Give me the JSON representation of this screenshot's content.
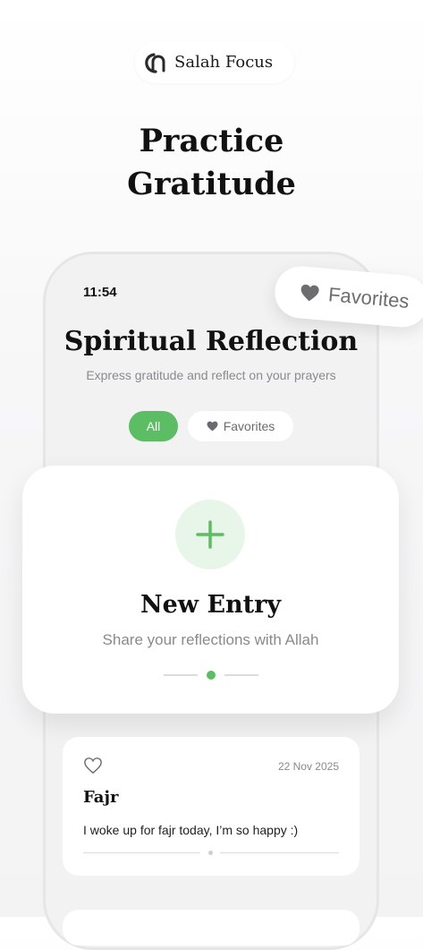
{
  "brand": {
    "name": "Salah Focus",
    "logo_icon": "salah-focus-logo-icon"
  },
  "headline": {
    "line1": "Practice",
    "line2": "Gratitude"
  },
  "status_bar": {
    "time": "11:54"
  },
  "floating_badge": {
    "label": "Favorites",
    "icon": "heart-icon"
  },
  "screen": {
    "title": "Spiritual Reflection",
    "subtitle": "Express gratitude and reflect on your prayers",
    "filters": {
      "all": "All",
      "favorites": "Favorites"
    }
  },
  "new_entry": {
    "title": "New Entry",
    "subtitle": "Share your reflections with Allah",
    "icon": "plus-icon"
  },
  "entries": [
    {
      "date": "22 Nov 2025",
      "prayer": "Fajr",
      "text": "I woke up for fajr today, I’m so happy :)",
      "favorite": false
    }
  ],
  "colors": {
    "accent": "#5cbd64",
    "accent_light": "#e8f5e9",
    "text": "#111111",
    "muted": "#8a8a8e"
  }
}
